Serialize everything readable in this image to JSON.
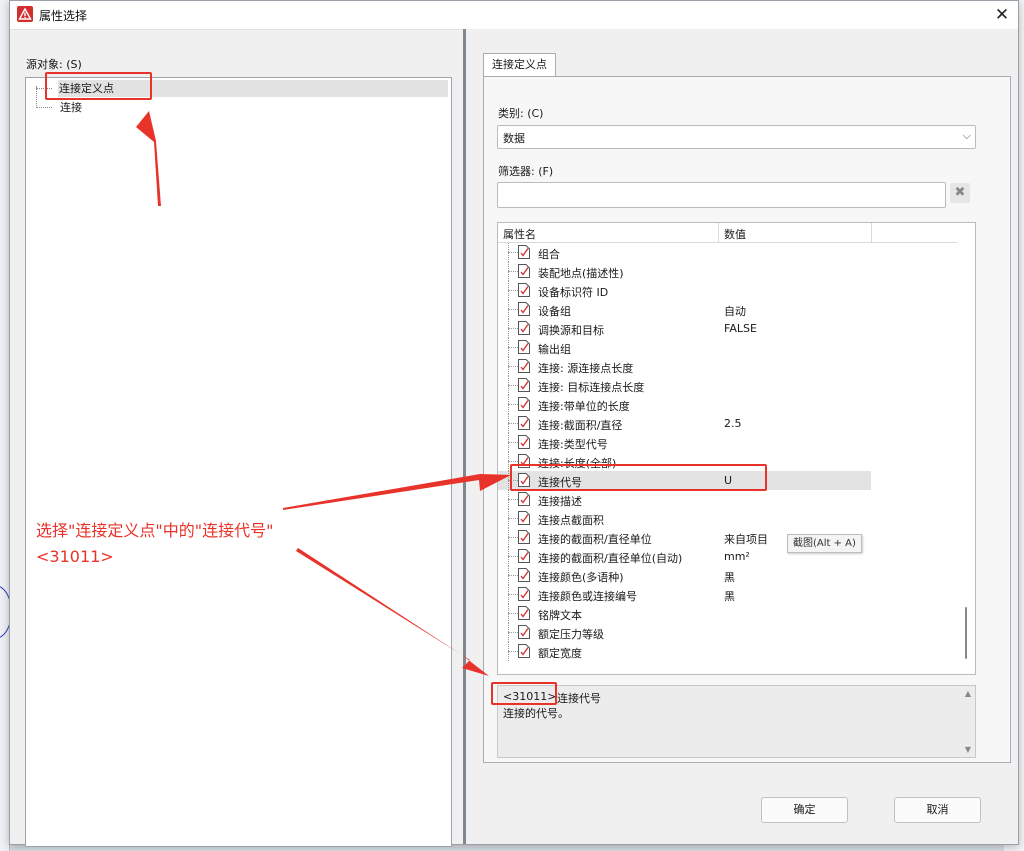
{
  "window": {
    "title": "属性选择",
    "close_glyph": "✕"
  },
  "left_pane": {
    "source_label": "源对象: (S)",
    "tree_items": [
      {
        "label": "连接定义点",
        "selected": true
      },
      {
        "label": "连接",
        "selected": false
      }
    ]
  },
  "right_pane": {
    "tab_label": "连接定义点",
    "category": {
      "label": "类别: (C)",
      "value": "数据"
    },
    "filter": {
      "label": "筛选器: (F)",
      "value": "",
      "clear_glyph": "✖"
    },
    "grid": {
      "headers": {
        "name": "属性名",
        "value": "数值"
      },
      "rows": [
        {
          "name": "组合",
          "value": ""
        },
        {
          "name": "装配地点(描述性)",
          "value": ""
        },
        {
          "name": "设备标识符 ID",
          "value": ""
        },
        {
          "name": "设备组",
          "value": "自动"
        },
        {
          "name": "调换源和目标",
          "value": "FALSE"
        },
        {
          "name": "输出组",
          "value": ""
        },
        {
          "name": "连接: 源连接点长度",
          "value": ""
        },
        {
          "name": "连接: 目标连接点长度",
          "value": ""
        },
        {
          "name": "连接:带单位的长度",
          "value": ""
        },
        {
          "name": "连接:截面积/直径",
          "value": "2.5"
        },
        {
          "name": "连接:类型代号",
          "value": ""
        },
        {
          "name": "连接:长度(全部)",
          "value": ""
        },
        {
          "name": "连接代号",
          "value": "U",
          "selected": true
        },
        {
          "name": "连接描述",
          "value": ""
        },
        {
          "name": "连接点截面积",
          "value": ""
        },
        {
          "name": "连接的截面积/直径单位",
          "value": "来自项目"
        },
        {
          "name": "连接的截面积/直径单位(自动)",
          "value": "mm²"
        },
        {
          "name": "连接颜色(多语种)",
          "value": "黑"
        },
        {
          "name": "连接颜色或连接编号",
          "value": "黑"
        },
        {
          "name": "铭牌文本",
          "value": ""
        },
        {
          "name": "额定压力等级",
          "value": ""
        },
        {
          "name": "额定宽度",
          "value": ""
        }
      ]
    },
    "description": {
      "id": "<31011>",
      "title": "连接代号",
      "text": "连接的代号。"
    },
    "buttons": {
      "ok": "确定",
      "cancel": "取消"
    }
  },
  "tooltip": "截图(Alt + A)",
  "annotation": {
    "text": "选择\"连接定义点\"中的\"连接代号\"",
    "code": "<31011>",
    "color": "#e8332b"
  },
  "colors": {
    "accent_red": "#e8332b",
    "selection_gray": "#e3e3e3"
  }
}
